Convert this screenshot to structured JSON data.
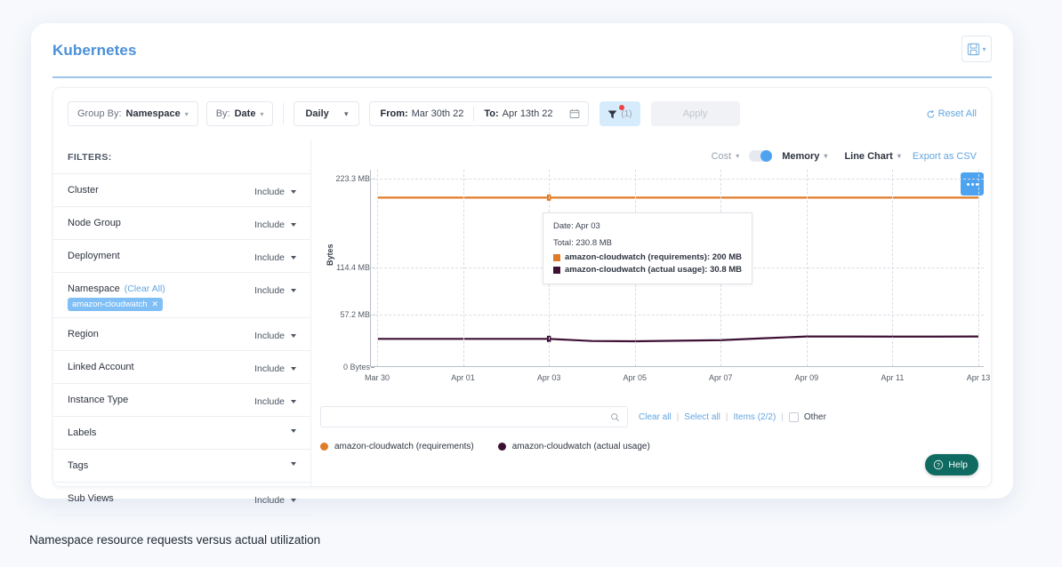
{
  "header": {
    "title": "Kubernetes",
    "save_icon": "floppy-disk-icon",
    "save_chevron": "chevron-down-icon"
  },
  "toolbar": {
    "group_by_label": "Group By:",
    "group_by_value": "Namespace",
    "by_label": "By:",
    "by_value": "Date",
    "granularity": "Daily",
    "from_label": "From:",
    "from_value": "Mar 30th 22",
    "to_label": "To:",
    "to_value": "Apr 13th 22",
    "calendar_icon": "calendar-icon",
    "filter_icon": "funnel-icon",
    "filter_count": "(1)",
    "apply_label": "Apply",
    "reset_label": "Reset All",
    "reset_icon": "refresh-icon"
  },
  "filters": {
    "heading": "FILTERS:",
    "include_label": "Include",
    "clear_all_label": "(Clear All)",
    "items": [
      {
        "name": "Cluster",
        "mode": "Include",
        "chips": []
      },
      {
        "name": "Node Group",
        "mode": "Include",
        "chips": []
      },
      {
        "name": "Deployment",
        "mode": "Include",
        "chips": []
      },
      {
        "name": "Namespace",
        "mode": "Include",
        "clear_all": "(Clear All)",
        "chips": [
          "amazon-cloudwatch"
        ]
      },
      {
        "name": "Region",
        "mode": "Include",
        "chips": []
      },
      {
        "name": "Linked Account",
        "mode": "Include",
        "chips": []
      },
      {
        "name": "Instance Type",
        "mode": "Include",
        "chips": []
      },
      {
        "name": "Labels",
        "mode": "",
        "chips": []
      },
      {
        "name": "Tags",
        "mode": "",
        "chips": []
      },
      {
        "name": "Sub Views",
        "mode": "Include",
        "chips": []
      }
    ]
  },
  "chart_controls": {
    "cost_label": "Cost",
    "memory_label": "Memory",
    "toggle_state": "memory",
    "chart_type": "Line Chart",
    "export_label": "Export as CSV",
    "kebab_icon": "more-options-icon"
  },
  "tooltip": {
    "date": "Date: Apr 03",
    "total": "Total: 230.8 MB",
    "rows": [
      {
        "label": "amazon-cloudwatch (requirements): 200 MB",
        "color": "#e07b28"
      },
      {
        "label": "amazon-cloudwatch (actual usage): 30.8 MB",
        "color": "#3d1034"
      }
    ]
  },
  "legend_controls": {
    "search_placeholder": "",
    "search_value": "",
    "search_icon": "search-icon",
    "clear_all": "Clear all",
    "select_all": "Select all",
    "items_count": "Items (2/2)",
    "other_label": "Other"
  },
  "legend": [
    {
      "label": "amazon-cloudwatch (requirements)",
      "color": "#e07b28"
    },
    {
      "label": "amazon-cloudwatch (actual usage)",
      "color": "#3d1034"
    }
  ],
  "help": {
    "label": "Help",
    "icon": "question-circle-icon"
  },
  "caption": "Namespace resource requests versus actual utilization",
  "chart_data": {
    "type": "line",
    "title": "",
    "xlabel": "",
    "ylabel": "Bytes",
    "ylim": [
      0,
      223.3
    ],
    "yunit": "MB",
    "yticks": [
      0,
      57.2,
      114.4,
      223.3
    ],
    "ytick_labels": [
      "0 Bytes",
      "57.2 MB",
      "114.4 MB",
      "223.3 MB"
    ],
    "ytick_positions_pct": [
      0,
      26.5,
      50.5,
      95.5
    ],
    "grid": true,
    "legend_position": "bottom",
    "x": [
      "Mar 30",
      "Mar 31",
      "Apr 01",
      "Apr 02",
      "Apr 03",
      "Apr 04",
      "Apr 05",
      "Apr 06",
      "Apr 07",
      "Apr 08",
      "Apr 09",
      "Apr 10",
      "Apr 11",
      "Apr 12",
      "Apr 13"
    ],
    "xtick_labels": [
      "Mar 30",
      "Apr 01",
      "Apr 03",
      "Apr 05",
      "Apr 07",
      "Apr 09",
      "Apr 11",
      "Apr 13"
    ],
    "xtick_indices": [
      0,
      2,
      4,
      6,
      8,
      10,
      12,
      14
    ],
    "highlight_x": "Apr 03",
    "series": [
      {
        "name": "amazon-cloudwatch (requirements)",
        "color": "#e07b28",
        "values": [
          200,
          200,
          200,
          200,
          200,
          200,
          200,
          200,
          200,
          200,
          200,
          200,
          200,
          200,
          200
        ]
      },
      {
        "name": "amazon-cloudwatch (actual usage)",
        "color": "#3d1034",
        "values": [
          30.8,
          30.8,
          30.8,
          30.8,
          30.8,
          28.5,
          28.2,
          28.8,
          29.4,
          31.5,
          33.4,
          33.4,
          33.3,
          33.3,
          33.4
        ]
      }
    ]
  }
}
